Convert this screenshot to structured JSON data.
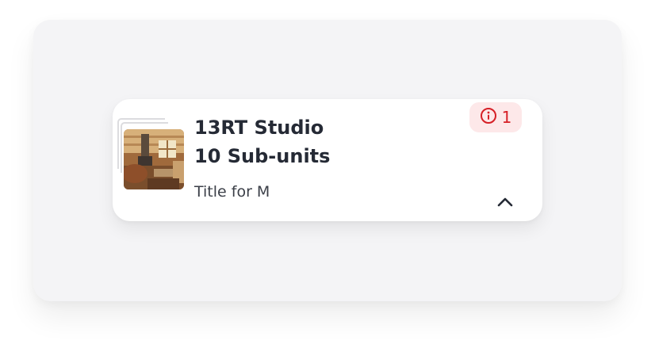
{
  "card": {
    "title": "13RT Studio",
    "subunits": "10 Sub-units",
    "caption": "Title for M",
    "thumbnail_icon": "room-photo-icon",
    "alert": {
      "icon": "info-circle-icon",
      "count": "1",
      "color": "#d61f26",
      "background": "#fde8e9"
    },
    "toggle_icon": "chevron-up-icon"
  },
  "colors": {
    "text_primary": "#252a35",
    "panel_bg": "#f4f4f6",
    "card_bg": "#ffffff"
  }
}
